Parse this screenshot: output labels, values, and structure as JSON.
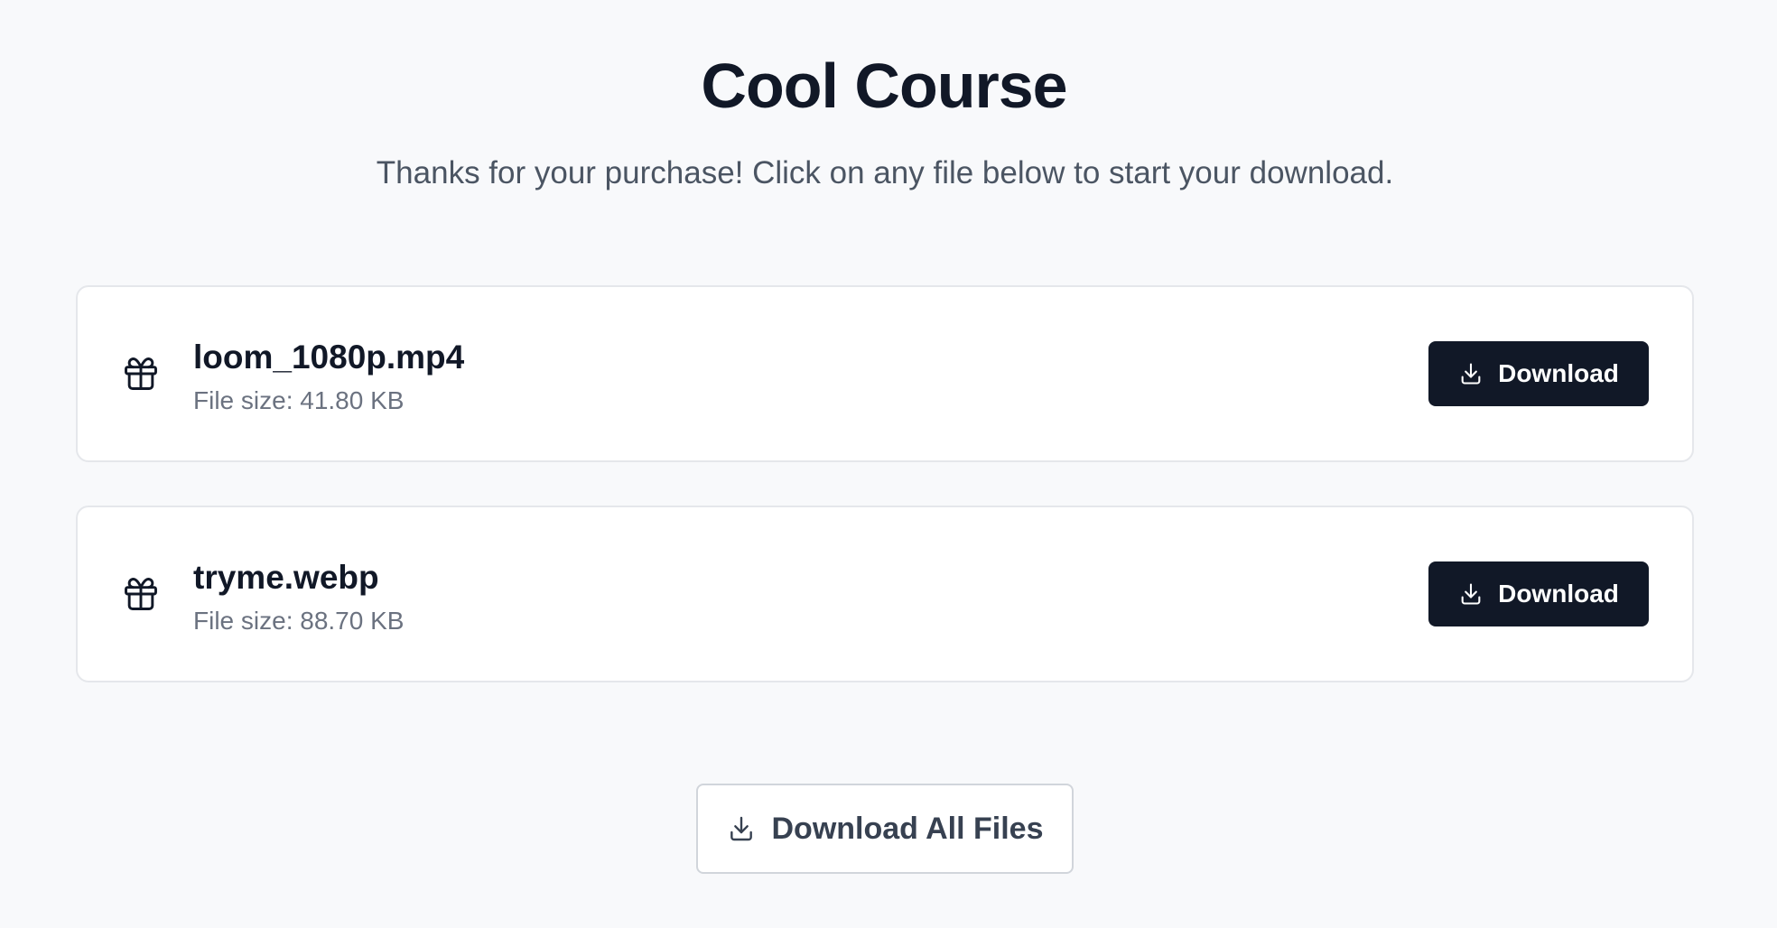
{
  "header": {
    "title": "Cool Course",
    "subtitle": "Thanks for your purchase! Click on any file below to start your download."
  },
  "files": [
    {
      "icon": "gift-icon",
      "name": "loom_1080p.mp4",
      "size_text": "File size: 41.80 KB",
      "button_label": "Download",
      "button_icon": "download-icon"
    },
    {
      "icon": "gift-icon",
      "name": "tryme.webp",
      "size_text": "File size: 88.70 KB",
      "button_label": "Download",
      "button_icon": "download-icon"
    }
  ],
  "footer": {
    "download_all_label": "Download All Files",
    "download_all_icon": "download-icon"
  },
  "colors": {
    "background": "#f8f9fb",
    "primary_button": "#111827",
    "primary_button_text": "#ffffff",
    "card_border": "#e5e7eb",
    "muted_text": "#6b7280"
  }
}
